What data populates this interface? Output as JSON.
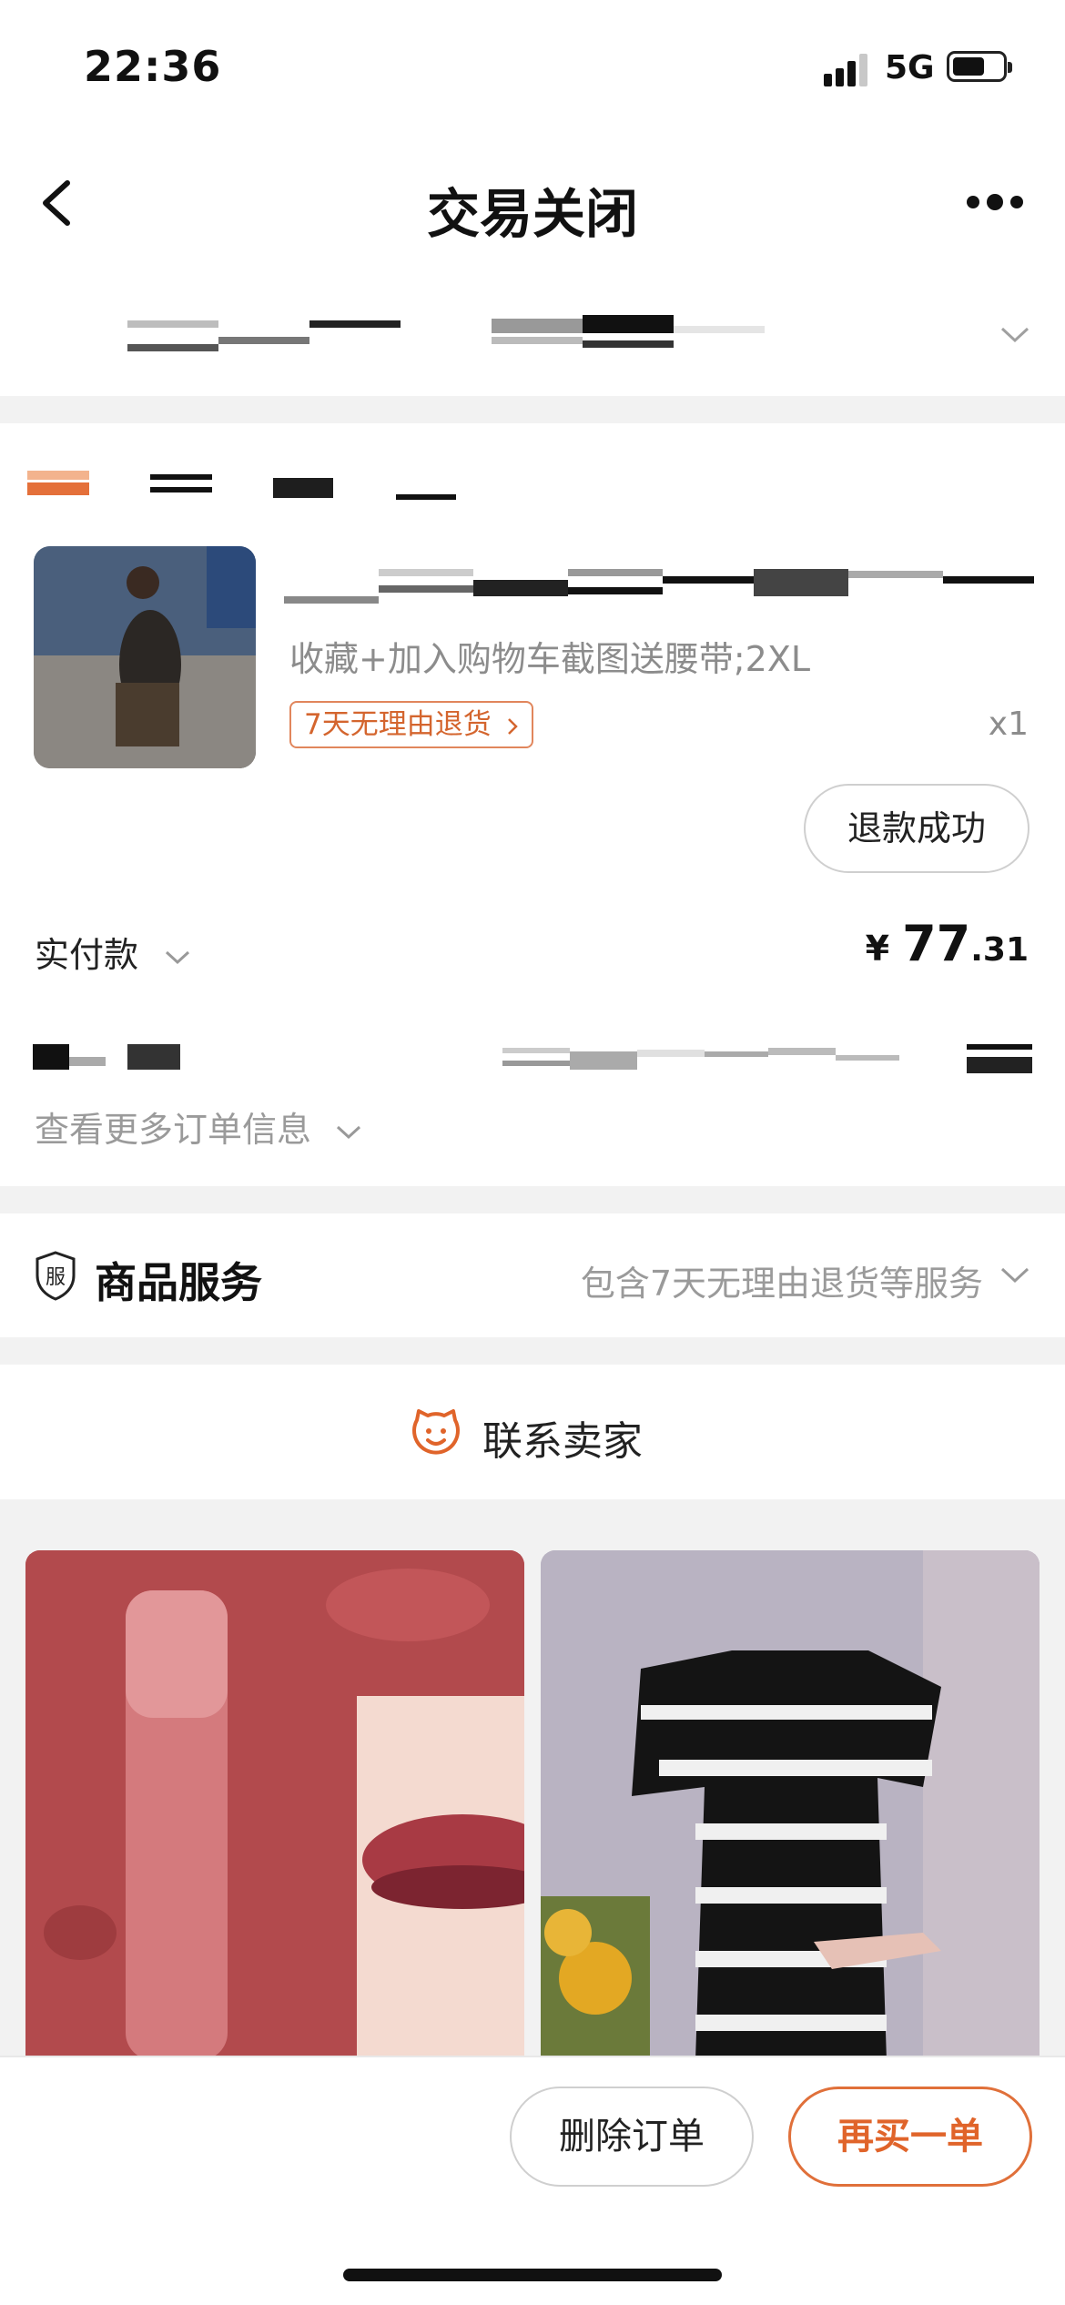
{
  "status_bar": {
    "time": "22:36",
    "network": "5G",
    "icons": [
      "signal-icon",
      "battery-icon"
    ]
  },
  "nav": {
    "title": "交易关闭",
    "icons": [
      "back-icon",
      "more-icon"
    ]
  },
  "order": {
    "product_spec": "收藏+加入购物车截图送腰带;2XL",
    "return_tag": "7天无理由退货",
    "quantity": "x1",
    "refund_status": "退款成功",
    "paid_label": "实付款",
    "currency": "¥",
    "amount_integer": "77",
    "amount_decimal": ".31",
    "more_info": "查看更多订单信息"
  },
  "service": {
    "title": "商品服务",
    "icon_char": "服",
    "description": "包含7天无理由退货等服务"
  },
  "contact": {
    "label": "联系卖家",
    "icon": "seller-face-icon"
  },
  "actions": {
    "delete_label": "删除订单",
    "rebuy_label": "再买一单"
  },
  "colors": {
    "accent": "#e0642a",
    "tag_border": "#e1865c",
    "muted_text": "#9a9a9a",
    "page_background": "#f2f2f2"
  }
}
